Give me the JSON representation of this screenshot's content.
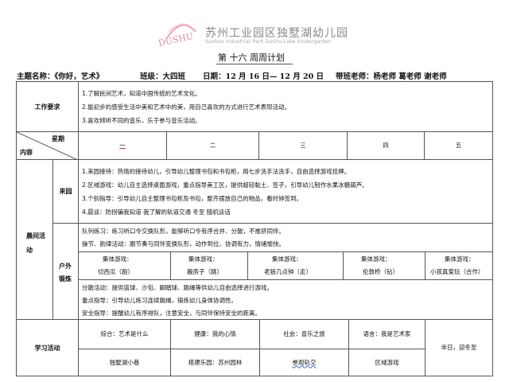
{
  "header": {
    "logo_text": "苏州工业园区独墅湖幼儿园",
    "logo_subtitle": "Suzhou Industrial Park Dushu Lake kindergarten",
    "logo_mark": "DUSHU",
    "title": "第 十六 周周计划"
  },
  "info": {
    "theme": "主题名称：《你好，艺术》",
    "class": "班级：大四班",
    "date": "日期：12 月 16 日— 12 月 20 日",
    "teachers": "带班老师：杨老师   葛老师   谢老师"
  },
  "table": {
    "work_label": "工作要求",
    "work_items": [
      "1.了解民间艺术，知道中国传统的艺术文化。",
      "2.能初步的感受生活中美和艺术中的美，用自己喜欢的方式进行艺术表现活动。",
      "3.喜欢倾听不同的音乐，乐于参与音乐活动。"
    ],
    "corner_week": "星期",
    "corner_content": "内容",
    "days": [
      "一",
      "二",
      "三",
      "四",
      "五"
    ],
    "morning_label": "晨间活动",
    "arrival_label": "来园",
    "arrival_items": [
      "1.来园接待：热情的接待幼儿，引导幼儿整理书包和书包柜，用七步洗手法洗手，自由选择游戏挂牌。",
      "2.区域游戏：幼儿自主选择桌面游戏，重点指导美工区，提供超轻黏土、签子，引导幼儿制作水果冰糖葫芦。",
      "3.个别指导：引导幼儿自主整理书包柜及书包，整齐摆放自己的物品，看时钟签到。",
      "4.晨谈：防拐骗我知道      我了解的轨道交通        冬至      随机谈话"
    ],
    "outdoor_label": "户外锻炼",
    "outdoor_top": [
      "队列练习：练习听口令交换队形，能够听口令有序合并、分散，不推挤同伴。",
      "操节、韵律活动：跟节奏与同伴变换队形，动作到位、协调有力，情绪愉快。"
    ],
    "group_game_label": "集体游戏：",
    "group_games": [
      "切西瓜（跑）",
      "搬房子（跳）",
      "老狼几点钟（走）",
      "伦敦桥（钻）",
      "小孩真爱玩（合作）"
    ],
    "outdoor_bottom": [
      "分散活动：提供篮球、沙包、脚踏球、跳绳等供幼儿自由选择进行游戏。",
      "重点指导：引导幼儿练习连续跳绳，锻炼幼儿身体协调性。",
      "安全指导：提醒幼儿有序排队，注意安全，与同伴保持安全的距离。"
    ],
    "study_label": "学习活动",
    "study_top": [
      "综合：艺术是什么",
      "健康：我的心情",
      "社会：音乐之旅",
      "语言：我是艺术家"
    ],
    "study_bottom": [
      "独墅湖小巷",
      "搭建乐园：苏州园林",
      "参观轨交",
      "区域游戏"
    ],
    "study_friday": "半日，迎冬至"
  }
}
